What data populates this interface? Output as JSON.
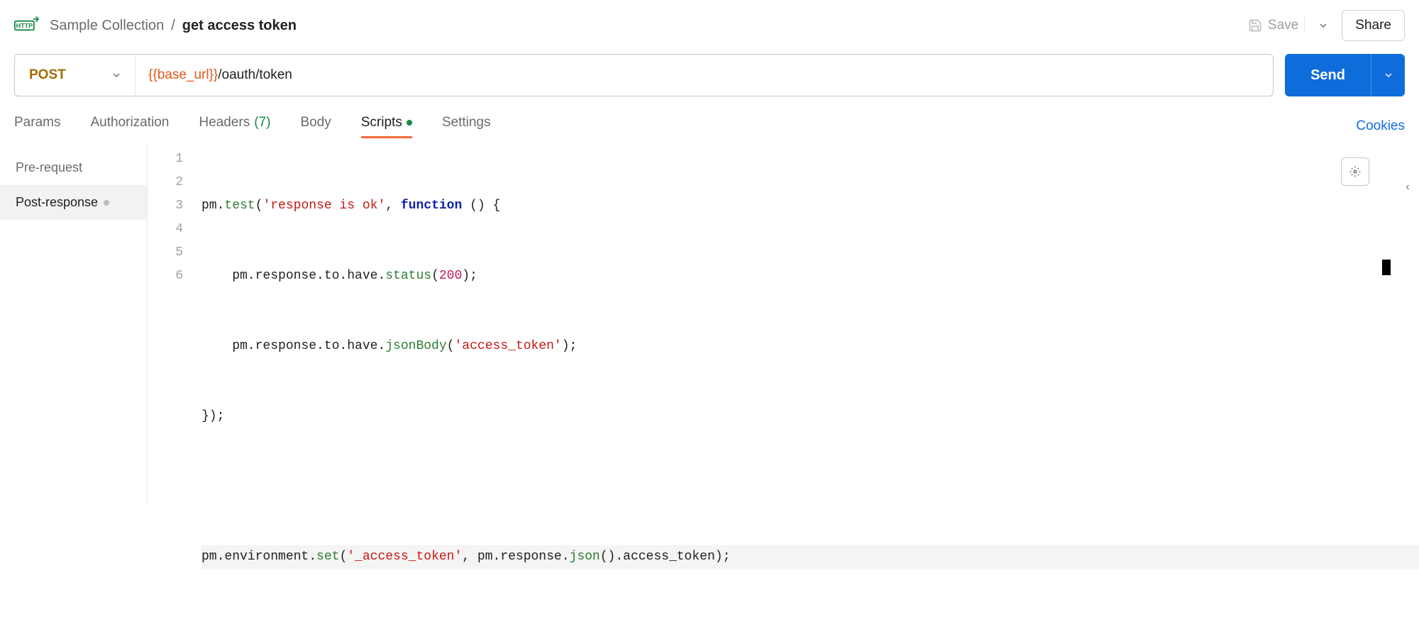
{
  "breadcrumb": {
    "parent": "Sample Collection",
    "current": "get access token"
  },
  "header_actions": {
    "save_label": "Save",
    "share_label": "Share"
  },
  "request": {
    "method": "POST",
    "url_variable": "{{base_url}}",
    "url_path": "/oauth/token",
    "send_label": "Send"
  },
  "tabs": {
    "params": "Params",
    "authorization": "Authorization",
    "headers": "Headers",
    "headers_count": "(7)",
    "body": "Body",
    "scripts": "Scripts",
    "settings": "Settings",
    "cookies": "Cookies"
  },
  "script_tabs": {
    "pre_request": "Pre-request",
    "post_response": "Post-response"
  },
  "code": {
    "gutter": [
      "1",
      "2",
      "3",
      "4",
      "5",
      "6"
    ],
    "lines": {
      "l1_a": "pm.",
      "l1_b": "test",
      "l1_c": "(",
      "l1_d": "'response is ok'",
      "l1_e": ", ",
      "l1_f": "function",
      "l1_g": " () {",
      "l2": "    pm.response.to.have.",
      "l2_b": "status",
      "l2_c": "(",
      "l2_d": "200",
      "l2_e": ");",
      "l3": "    pm.response.to.have.",
      "l3_b": "jsonBody",
      "l3_c": "(",
      "l3_d": "'access_token'",
      "l3_e": ");",
      "l4": "});",
      "l5": "",
      "l6_a": "pm.environment.",
      "l6_b": "set",
      "l6_c": "(",
      "l6_d": "'_access_token'",
      "l6_e": ", pm.response.",
      "l6_f": "json",
      "l6_g": "().access_token);"
    }
  }
}
